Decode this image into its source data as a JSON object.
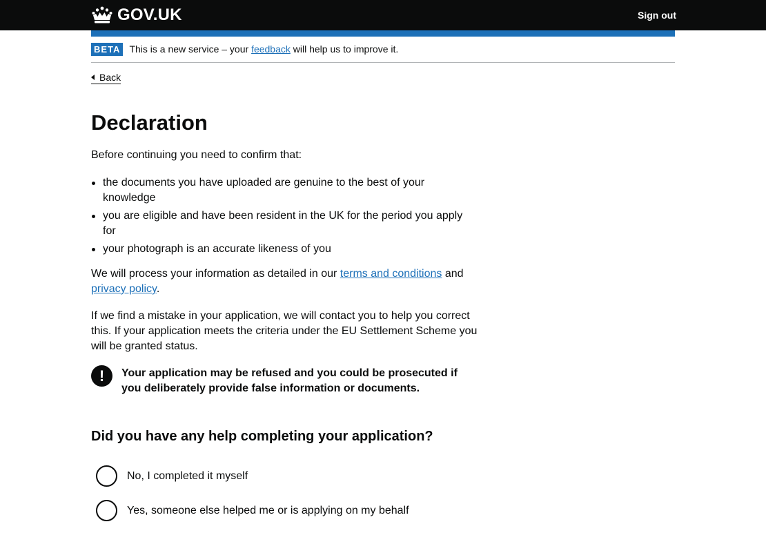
{
  "header": {
    "logo_text": "GOV.UK",
    "sign_out_label": "Sign out"
  },
  "phase_banner": {
    "tag": "BETA",
    "text_before": "This is a new service – your ",
    "feedback_link": "feedback",
    "text_after": " will help us to improve it."
  },
  "back_link": "Back",
  "main": {
    "title": "Declaration",
    "intro": "Before continuing you need to confirm that:",
    "bullets": [
      "the documents you have uploaded are genuine to the best of your knowledge",
      "you are eligible and have been resident in the UK for the period you apply for",
      "your photograph is an accurate likeness of you"
    ],
    "terms_text_before": "We will process your information as detailed in our ",
    "terms_link": "terms and conditions",
    "terms_text_middle": " and ",
    "privacy_link": "privacy policy",
    "terms_text_after": ".",
    "mistake_text": "If we find a mistake in your application, we will contact you to help you correct this. If your application meets the criteria under the EU Settlement Scheme you will be granted status.",
    "warning_icon": "!",
    "warning_text": "Your application may be refused and you could be prosecuted if you deliberately provide false information or documents."
  },
  "question": {
    "title": "Did you have any help completing your application?",
    "options": [
      "No, I completed it myself",
      "Yes, someone else helped me or is applying on my behalf"
    ]
  },
  "colors": {
    "header_bg": "#0b0c0c",
    "brand_blue": "#1d70b8",
    "link": "#1d70b8",
    "text": "#0b0c0c",
    "border": "#b1b4b6"
  },
  "icons": {
    "logo": "crown-icon",
    "back": "triangle-left-icon",
    "warning": "exclamation-warning-icon"
  }
}
